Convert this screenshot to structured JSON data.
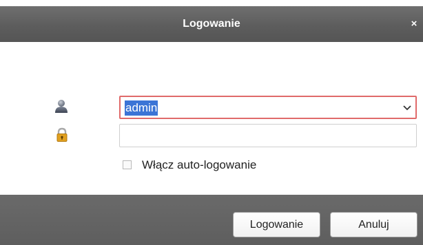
{
  "dialog": {
    "title": "Logowanie",
    "close_label": "×",
    "username": {
      "value": "admin",
      "icon": "user-icon",
      "dropdown_icon": "chevron-down-icon"
    },
    "password": {
      "value": "",
      "icon": "lock-icon"
    },
    "auto_login": {
      "label": "Włącz auto-logowanie",
      "checked": false
    },
    "buttons": {
      "login_label": "Logowanie",
      "cancel_label": "Anuluj"
    }
  },
  "colors": {
    "titlebar": "#5d5d5d",
    "footer": "#626262",
    "focus_border": "#e06a6a",
    "selection": "#3b74d6",
    "lock_gold": "#e0a020"
  }
}
